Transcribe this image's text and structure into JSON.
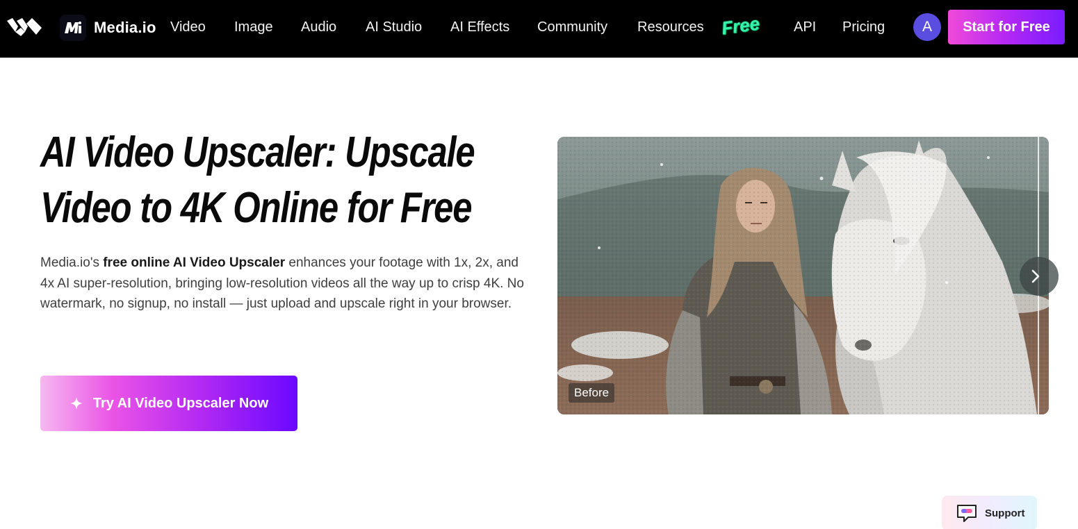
{
  "nav": {
    "brand": "Media.io",
    "items": [
      "Video",
      "Image",
      "Audio",
      "AI Studio",
      "AI Effects",
      "Community",
      "Resources"
    ],
    "free_badge": "Free",
    "api": "API",
    "pricing": "Pricing",
    "avatar_letter": "A",
    "start_button": "Start for Free"
  },
  "hero": {
    "title_line1": "AI Video Upscaler: Upscale",
    "title_line2": "Video to 4K Online for Free",
    "desc_prefix": "Media.io's ",
    "desc_bold": "free online AI Video Upscaler",
    "desc_rest": " enhances your footage with 1x, 2x, and 4x AI super-resolution, bringing low-resolution videos all the way up to crisp 4K. No watermark, no signup, no install — just upload and upscale right in your browser.",
    "cta": "Try AI Video Upscaler Now"
  },
  "media": {
    "before_label": "Before"
  },
  "support": {
    "label": "Support"
  },
  "colors": {
    "nav_bg": "#000000",
    "accent_purple": "#7a1cff",
    "accent_pink": "#f04ad9",
    "avatar": "#5a4ee0"
  }
}
